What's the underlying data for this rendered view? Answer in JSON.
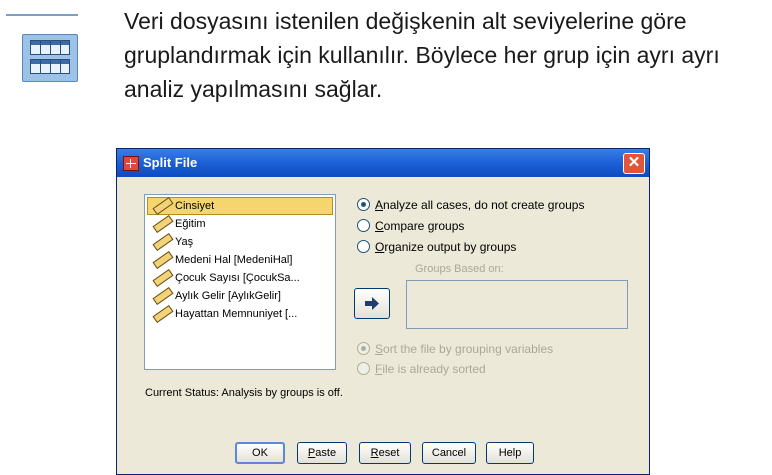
{
  "description": "Veri dosyasını istenilen değişkenin alt seviyelerine göre gruplandırmak için kullanılır. Böylece her grup için ayrı ayrı analiz yapılmasını sağlar.",
  "dialog": {
    "title": "Split File",
    "variables": [
      {
        "label": "Cinsiyet",
        "selected": true
      },
      {
        "label": "Eğitim",
        "selected": false
      },
      {
        "label": "Yaş",
        "selected": false
      },
      {
        "label": "Medeni Hal [MedeniHal]",
        "selected": false
      },
      {
        "label": "Çocuk Sayısı [ÇocukSa...",
        "selected": false
      },
      {
        "label": "Aylık Gelir [AylıkGelir]",
        "selected": false
      },
      {
        "label": "Hayattan Memnuniyet [...",
        "selected": false
      }
    ],
    "options": {
      "analyze_all": {
        "key": "A",
        "rest": "nalyze all cases, do not create groups",
        "checked": true
      },
      "compare": {
        "key": "C",
        "rest": "ompare groups",
        "checked": false
      },
      "organize": {
        "key": "O",
        "rest": "rganize output by groups",
        "checked": false
      }
    },
    "groups_based_on": "Groups Based on:",
    "sort_options": {
      "sort_file": {
        "key": "S",
        "rest": "ort the file by grouping variables",
        "checked": true,
        "enabled": false
      },
      "already_sorted": {
        "key": "F",
        "rest": "ile is already sorted",
        "checked": false,
        "enabled": false
      }
    },
    "status": "Current Status: Analysis by groups is off.",
    "buttons": {
      "ok": "OK",
      "paste_key": "P",
      "paste_rest": "aste",
      "reset_key": "R",
      "reset_rest": "eset",
      "cancel": "Cancel",
      "help": "Help"
    },
    "colors": {
      "titlebar": "#1d5fd6",
      "close": "#e0563b",
      "selection": "#f6d56f",
      "dialog_bg": "#ece9d8"
    }
  }
}
